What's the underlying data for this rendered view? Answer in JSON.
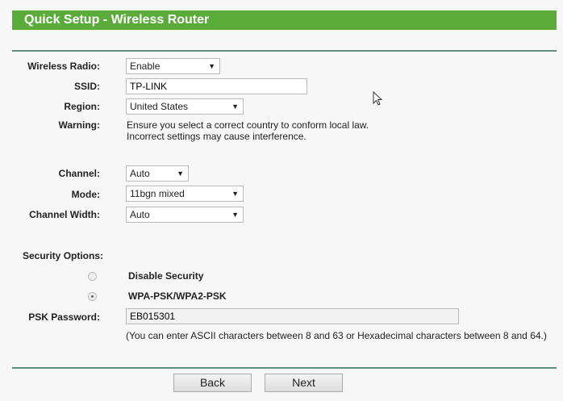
{
  "header": {
    "title": "Quick Setup - Wireless Router"
  },
  "form": {
    "wireless_radio": {
      "label": "Wireless Radio:",
      "value": "Enable"
    },
    "ssid": {
      "label": "SSID:",
      "value": "TP-LINK"
    },
    "region": {
      "label": "Region:",
      "value": "United States"
    },
    "warning": {
      "label": "Warning:",
      "line1": "Ensure you select a correct country to conform local law.",
      "line2": "Incorrect settings may cause interference."
    },
    "channel": {
      "label": "Channel:",
      "value": "Auto"
    },
    "mode": {
      "label": "Mode:",
      "value": "11bgn mixed"
    },
    "channel_width": {
      "label": "Channel Width:",
      "value": "Auto"
    },
    "security": {
      "label": "Security Options:",
      "options": [
        {
          "label": "Disable Security",
          "selected": false
        },
        {
          "label": "WPA-PSK/WPA2-PSK",
          "selected": true
        }
      ]
    },
    "psk": {
      "label": "PSK Password:",
      "value": "EB015301",
      "hint": "(You can enter ASCII characters between 8 and 63 or Hexadecimal characters between 8 and 64.)"
    }
  },
  "buttons": {
    "back": "Back",
    "next": "Next"
  },
  "icons": {
    "dropdown": "▼"
  }
}
